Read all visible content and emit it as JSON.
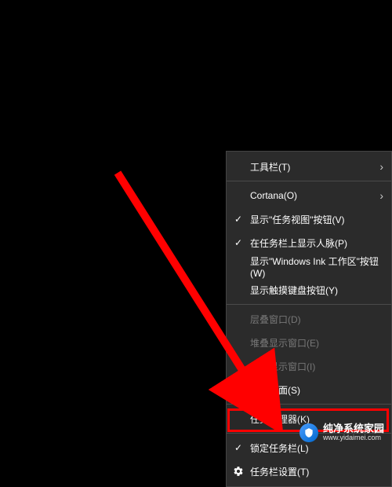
{
  "menu": {
    "items": [
      {
        "label": "工具栏(T)",
        "submenu": true,
        "checked": false,
        "disabled": false,
        "name": "menu-item-toolbars"
      },
      {
        "separator": true
      },
      {
        "label": "Cortana(O)",
        "submenu": true,
        "checked": false,
        "disabled": false,
        "name": "menu-item-cortana"
      },
      {
        "label": "显示\"任务视图\"按钮(V)",
        "submenu": false,
        "checked": true,
        "disabled": false,
        "name": "menu-item-task-view"
      },
      {
        "label": "在任务栏上显示人脉(P)",
        "submenu": false,
        "checked": true,
        "disabled": false,
        "name": "menu-item-people"
      },
      {
        "label": "显示\"Windows Ink 工作区\"按钮(W)",
        "submenu": false,
        "checked": false,
        "disabled": false,
        "name": "menu-item-ink"
      },
      {
        "label": "显示触摸键盘按钮(Y)",
        "submenu": false,
        "checked": false,
        "disabled": false,
        "name": "menu-item-touch-keyboard"
      },
      {
        "separator": true
      },
      {
        "label": "层叠窗口(D)",
        "submenu": false,
        "checked": false,
        "disabled": true,
        "name": "menu-item-cascade"
      },
      {
        "label": "堆叠显示窗口(E)",
        "submenu": false,
        "checked": false,
        "disabled": true,
        "name": "menu-item-stacked"
      },
      {
        "label": "并排显示窗口(I)",
        "submenu": false,
        "checked": false,
        "disabled": true,
        "name": "menu-item-side-by-side"
      },
      {
        "label": "显示桌面(S)",
        "submenu": false,
        "checked": false,
        "disabled": false,
        "name": "menu-item-show-desktop"
      },
      {
        "separator": true
      },
      {
        "label": "任务管理器(K)",
        "submenu": false,
        "checked": false,
        "disabled": false,
        "name": "menu-item-task-manager"
      },
      {
        "separator": true
      },
      {
        "label": "锁定任务栏(L)",
        "submenu": false,
        "checked": true,
        "disabled": false,
        "name": "menu-item-lock-taskbar"
      },
      {
        "label": "任务栏设置(T)",
        "submenu": false,
        "checked": false,
        "disabled": false,
        "gear": true,
        "name": "menu-item-taskbar-settings"
      }
    ]
  },
  "watermark": {
    "title": "纯净系统家园",
    "url": "www.yidaimei.com"
  }
}
